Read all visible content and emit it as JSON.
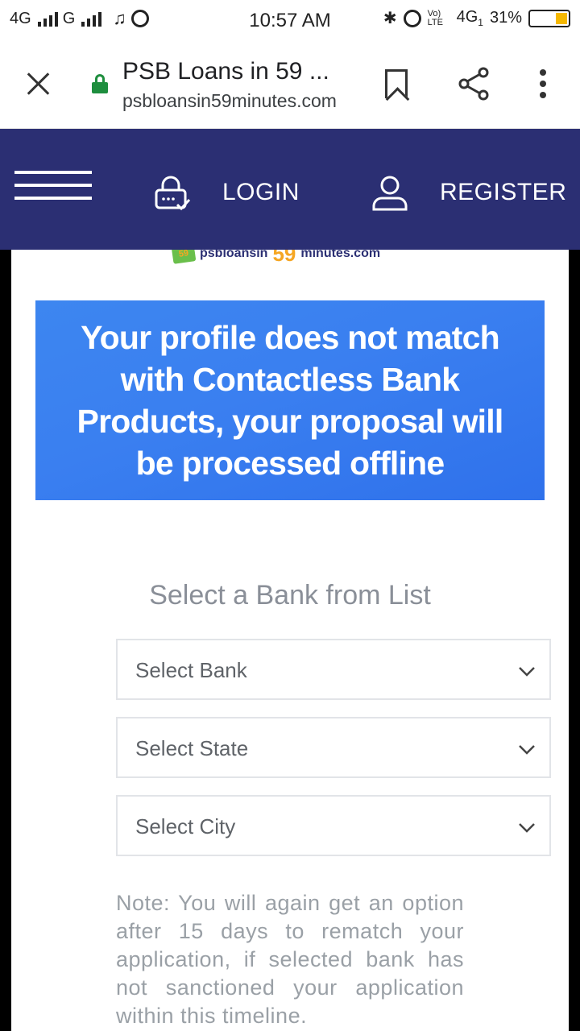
{
  "status_bar": {
    "network_left": "4G",
    "network_mid": "G",
    "music_icon": "music-note-icon",
    "alarm_icon": "alarm-icon",
    "time": "10:57 AM",
    "volte": "Vo) LTE",
    "network_right": "4G",
    "sim_index": "1",
    "battery_percent": "31%",
    "battery_level": 0.31,
    "battery_color": "#f5b800"
  },
  "browser": {
    "close_icon": "close-icon",
    "lock_icon": "lock-icon",
    "lock_color": "#1e8e3e",
    "page_title": "PSB Loans in 59 ...",
    "url": "psbloansin59minutes.com",
    "bookmark_icon": "bookmark-icon",
    "share_icon": "share-icon",
    "menu_icon": "more-vert-icon"
  },
  "nav": {
    "background": "#2b2f73",
    "menu_icon": "hamburger-icon",
    "login_icon": "login-lock-icon",
    "login_label": "LOGIN",
    "register_icon": "user-icon",
    "register_label": "REGISTER"
  },
  "logo": {
    "badge": "59",
    "text_left": "psbloansin",
    "text_num": "59",
    "text_right": "minutes.com"
  },
  "banner": {
    "message": "Your profile does not match with Contactless Bank Products, your proposal will be processed offline",
    "color": "#3a7ff0"
  },
  "form": {
    "heading": "Select a Bank from List",
    "bank_select": "Select Bank",
    "state_select": "Select State",
    "city_select": "Select City",
    "note": "Note: You will again get an option after 15 days to rematch your application, if selected bank has not sanctioned your application within this timeline."
  }
}
